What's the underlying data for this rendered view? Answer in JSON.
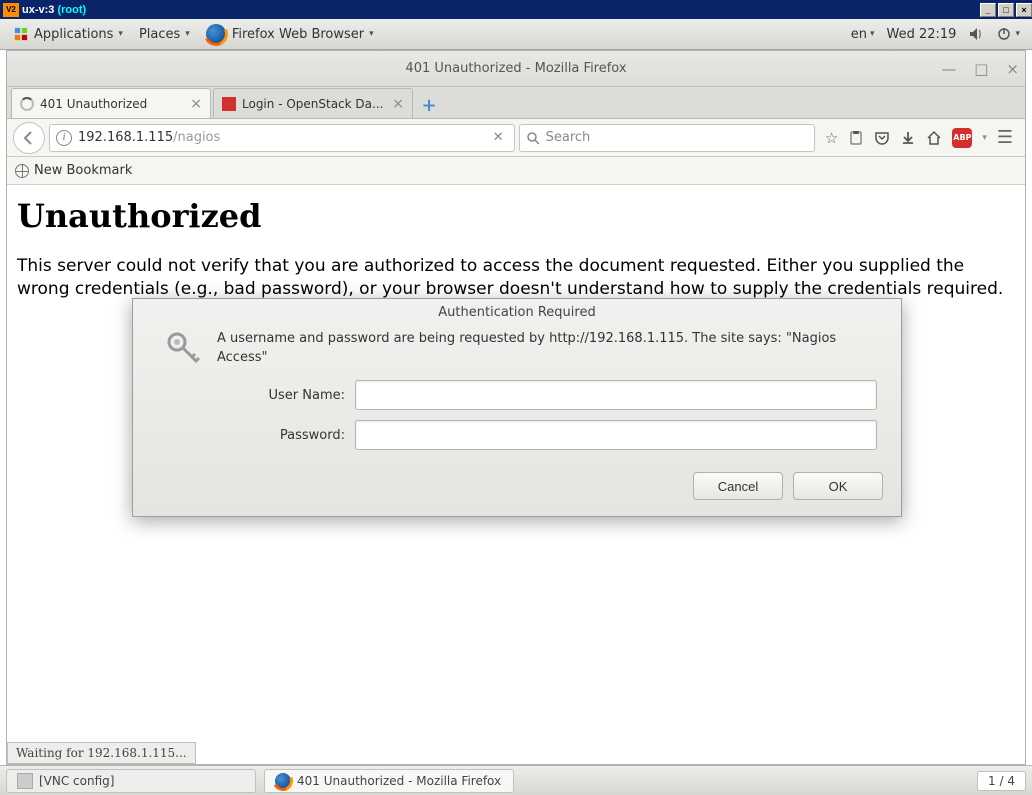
{
  "vnc": {
    "icon_text": "V2",
    "title_prefix": "ux-v:3 ",
    "title_suffix": "(root)"
  },
  "panel": {
    "applications": "Applications",
    "places": "Places",
    "firefox": "Firefox Web Browser",
    "lang": "en",
    "clock": "Wed 22:19"
  },
  "firefox": {
    "window_title": "401 Unauthorized - Mozilla Firefox",
    "tabs": [
      {
        "label": "401 Unauthorized",
        "loading": true
      },
      {
        "label": "Login - OpenStack Da...",
        "loading": false
      }
    ],
    "url_host": "192.168.1.115",
    "url_path": "/nagios",
    "search_placeholder": "Search",
    "bookmark": "New Bookmark",
    "status": "Waiting for 192.168.1.115..."
  },
  "page": {
    "heading": "Unauthorized",
    "body": "This server could not verify that you are authorized to access the document requested. Either you supplied the wrong credentials (e.g., bad password), or your browser doesn't understand how to supply the credentials required."
  },
  "auth": {
    "title": "Authentication Required",
    "message": "A username and password are being requested by http://192.168.1.115. The site says: \"Nagios Access\"",
    "username_label": "User Name:",
    "password_label": "Password:",
    "cancel": "Cancel",
    "ok": "OK"
  },
  "bottom": {
    "task1": "[VNC config]",
    "task2": "401 Unauthorized - Mozilla Firefox",
    "workspace": "1 / 4"
  }
}
